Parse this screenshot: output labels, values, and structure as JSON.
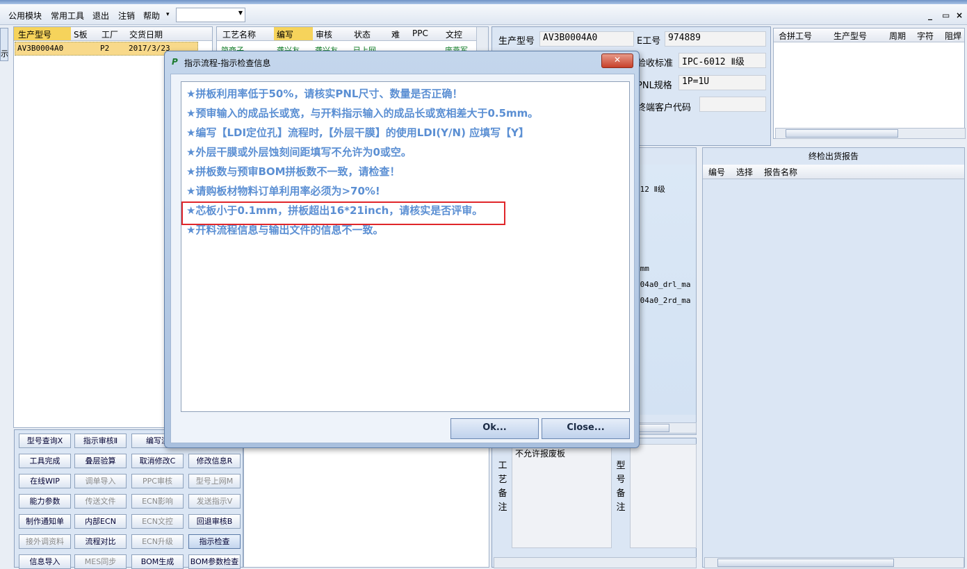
{
  "menu": {
    "items": [
      "公用模块",
      "常用工具",
      "退出",
      "注销",
      "帮助"
    ],
    "help_arrow": "▾",
    "combo_value": "",
    "win_controls": [
      "_",
      "▭",
      "×"
    ]
  },
  "left_side_tab": "示",
  "order_grid": {
    "headers": [
      "生产型号",
      "S板",
      "工厂",
      "交货日期"
    ],
    "row": {
      "model": "AV3B0004A0",
      "factory": "P2",
      "date": "2017/3/23"
    }
  },
  "process_grid": {
    "headers": [
      "工艺名称",
      "编写",
      "审核",
      "状态",
      "难",
      "PPC",
      "文控"
    ],
    "row": {
      "name": "简商子",
      "writer": "龚兴友",
      "auditor": "龚兴友",
      "status": "已上网",
      "doc": "庞燕军"
    }
  },
  "info_panel": {
    "model_label": "生产型号",
    "model_value": "AV3B0004A0",
    "e_label": "E工号",
    "e_value": "974889",
    "accept_label": "验收标准",
    "accept_value": "IPC-6012 Ⅱ级",
    "pnl_label": "PNL规格",
    "pnl_value": "1P=1U",
    "cust_label": "终端客户代码",
    "cust_value": ""
  },
  "merge_grid": {
    "headers": [
      "合拼工号",
      "生产型号",
      "周期",
      "字符",
      "阻焊"
    ]
  },
  "mid_list": {
    "values": [
      "012 Ⅱ级",
      "4mm",
      "004a0_drl_ma",
      "004a0_2rd_ma"
    ]
  },
  "report_panel": {
    "title": "终检出货报告",
    "headers": [
      "编号",
      "选择",
      "报告名称"
    ]
  },
  "remarks": {
    "process_label": "工艺备注",
    "process_text": "不允许报废板",
    "model_label": "型号备注"
  },
  "buttons": [
    {
      "label": "型号查询Ⅹ",
      "state": "normal"
    },
    {
      "label": "指示审核Ⅱ",
      "state": "normal"
    },
    {
      "label": "编写流",
      "state": "normal"
    },
    {
      "label": "",
      "state": "normal"
    },
    {
      "label": "工具完成",
      "state": "normal"
    },
    {
      "label": "叠层验算",
      "state": "normal"
    },
    {
      "label": "取消修改C",
      "state": "normal"
    },
    {
      "label": "修改信息R",
      "state": "normal"
    },
    {
      "label": "在线WIP",
      "state": "normal"
    },
    {
      "label": "调单导入",
      "state": "disabled"
    },
    {
      "label": "PPC审核",
      "state": "disabled"
    },
    {
      "label": "型号上网M",
      "state": "disabled"
    },
    {
      "label": "能力参数",
      "state": "normal"
    },
    {
      "label": "传送文件",
      "state": "disabled"
    },
    {
      "label": "ECN影响",
      "state": "disabled"
    },
    {
      "label": "发送指示V",
      "state": "disabled"
    },
    {
      "label": "制作通知单",
      "state": "normal"
    },
    {
      "label": "内部ECN",
      "state": "normal"
    },
    {
      "label": "ECN文控",
      "state": "disabled"
    },
    {
      "label": "回退审核B",
      "state": "normal"
    },
    {
      "label": "接外调资料",
      "state": "disabled"
    },
    {
      "label": "流程对比",
      "state": "normal"
    },
    {
      "label": "ECN升级",
      "state": "disabled"
    },
    {
      "label": "指示检查",
      "state": "active"
    },
    {
      "label": "信息导入",
      "state": "normal"
    },
    {
      "label": "MES同步",
      "state": "disabled"
    },
    {
      "label": "BOM生成",
      "state": "normal"
    },
    {
      "label": "BOM参数检查",
      "state": "normal"
    }
  ],
  "dialog": {
    "logo": "P",
    "title": "指示流程-指示检查信息",
    "close_glyph": "✕",
    "lines": [
      "★拼板利用率低于50%，请核实PNL尺寸、数量是否正确！",
      "★预审输入的成品长或宽，与开料指示输入的成品长或宽相差大于0.5mm。",
      "★编写【LDI定位孔】流程时,【外层干膜】的使用LDI(Y/N) 应填写【Y】",
      "★外层干膜或外层蚀刻间距填写不允许为0或空。",
      "★拼板数与预审BOM拼板数不一致，请检查！",
      "★请购板材物料订单利用率必须为>70%!",
      "★芯板小于0.1mm，拼板超出16*21inch，请核实是否评审。",
      "★开料流程信息与输出文件的信息不一致。"
    ],
    "highlighted_index": 6,
    "ok_label": "Ok...",
    "close_label": "Close...",
    "highlight_color": "#e0262a",
    "text_color": "#5b8fd3"
  }
}
